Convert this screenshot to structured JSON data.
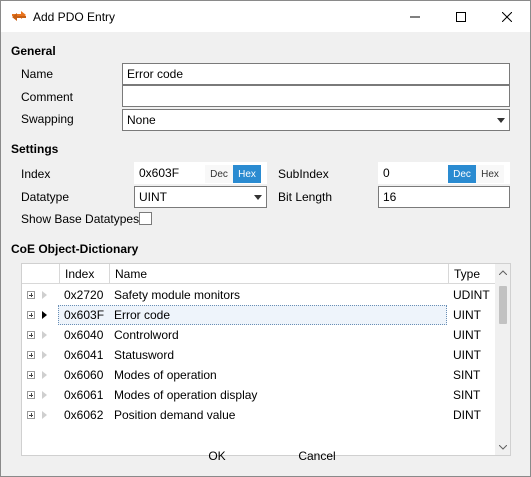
{
  "window": {
    "title": "Add PDO Entry",
    "icons": {
      "app": "pdo-arrow-icon",
      "minimize": "minimize-icon",
      "maximize": "maximize-icon",
      "close": "close-icon"
    }
  },
  "general": {
    "section_title": "General",
    "name_label": "Name",
    "name_value": "Error code",
    "comment_label": "Comment",
    "comment_value": "",
    "swapping_label": "Swapping",
    "swapping_value": "None"
  },
  "settings": {
    "section_title": "Settings",
    "index_label": "Index",
    "index_value": "0x603F",
    "index_toggle": {
      "dec": "Dec",
      "hex": "Hex",
      "selected": "Hex"
    },
    "subindex_label": "SubIndex",
    "subindex_value": "0",
    "subindex_toggle": {
      "dec": "Dec",
      "hex": "Hex",
      "selected": "Dec"
    },
    "datatype_label": "Datatype",
    "datatype_value": "UINT",
    "bitlength_label": "Bit Length",
    "bitlength_value": "16",
    "show_base_label": "Show Base Datatypes",
    "show_base_checked": false
  },
  "dictionary": {
    "section_title": "CoE Object-Dictionary",
    "columns": {
      "index": "Index",
      "name": "Name",
      "type": "Type"
    },
    "rows": [
      {
        "index": "0x2720",
        "name": "Safety module monitors",
        "type": "UDINT"
      },
      {
        "index": "0x603F",
        "name": "Error code",
        "type": "UINT"
      },
      {
        "index": "0x6040",
        "name": "Controlword",
        "type": "UINT"
      },
      {
        "index": "0x6041",
        "name": "Statusword",
        "type": "UINT"
      },
      {
        "index": "0x6060",
        "name": "Modes of operation",
        "type": "SINT"
      },
      {
        "index": "0x6061",
        "name": "Modes of operation display",
        "type": "SINT"
      },
      {
        "index": "0x6062",
        "name": "Position demand value",
        "type": "DINT"
      }
    ],
    "selected_row": 1
  },
  "buttons": {
    "ok": "OK",
    "cancel": "Cancel"
  },
  "colors": {
    "accent": "#2a8bd1",
    "selection": "#eef4fb"
  }
}
